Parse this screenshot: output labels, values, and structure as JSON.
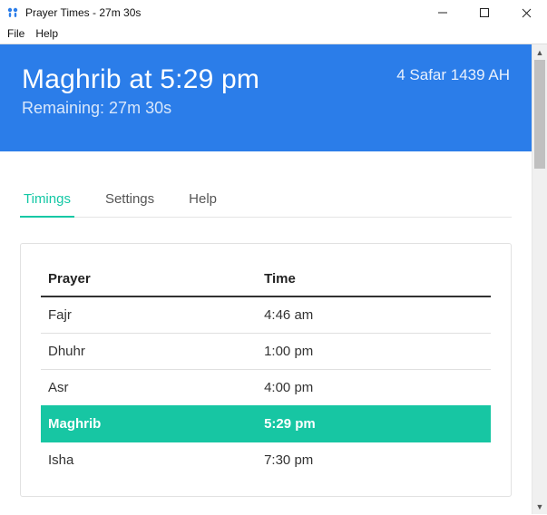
{
  "window": {
    "title": "Prayer Times - 27m 30s"
  },
  "menu": {
    "file": "File",
    "help": "Help"
  },
  "hero": {
    "headline": "Maghrib at 5:29 pm",
    "remaining": "Remaining: 27m 30s",
    "hijri_date": "4 Safar 1439 AH"
  },
  "tabs": {
    "timings": "Timings",
    "settings": "Settings",
    "help": "Help"
  },
  "table": {
    "header_prayer": "Prayer",
    "header_time": "Time",
    "rows": [
      {
        "prayer": "Fajr",
        "time": "4:46 am"
      },
      {
        "prayer": "Dhuhr",
        "time": "1:00 pm"
      },
      {
        "prayer": "Asr",
        "time": "4:00 pm"
      },
      {
        "prayer": "Maghrib",
        "time": "5:29 pm"
      },
      {
        "prayer": "Isha",
        "time": "7:30 pm"
      }
    ],
    "highlight_index": 3
  },
  "colors": {
    "accent_blue": "#2b7de9",
    "accent_teal": "#17c6a3"
  }
}
